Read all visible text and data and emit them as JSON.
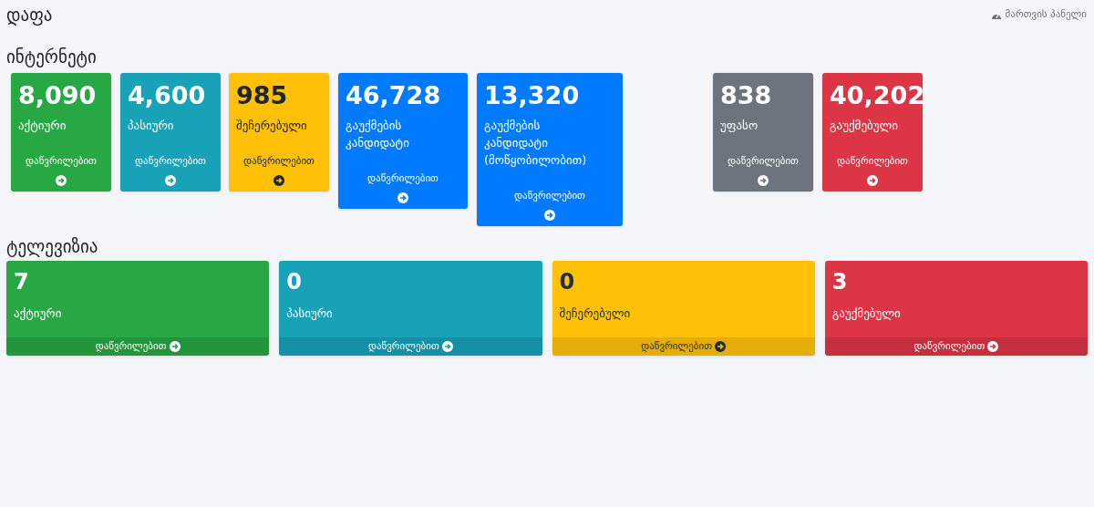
{
  "page_title": "დაფა",
  "breadcrumb": "მართვის პანელი",
  "internet": {
    "title": "ინტერნეტი",
    "cards": [
      {
        "value": "8,090",
        "label": "აქტიური",
        "color": "#28a745",
        "link": "დაწვრილებით"
      },
      {
        "value": "4,600",
        "label": "პასიური",
        "color": "#17a2b8",
        "link": "დაწვრილებით"
      },
      {
        "value": "985",
        "label": "შეჩერებული",
        "color": "#ffc107",
        "link": "დაწვრილებით"
      },
      {
        "value": "46,728",
        "label": "გაუქმების კანდიდატი",
        "color": "#007bff",
        "link": "დაწვრილებით"
      },
      {
        "value": "13,320",
        "label": "გაუქმების კანდიდატი (მოწყობილობით)",
        "color": "#007bff",
        "link": "დაწვრილებით"
      },
      {
        "value": "838",
        "label": "უფასო",
        "color": "#6c757d",
        "link": "დაწვრილებით"
      },
      {
        "value": "40,202",
        "label": "გაუქმებული",
        "color": "#dc3545",
        "link": "დაწვრილებით"
      }
    ]
  },
  "television": {
    "title": "ტელევიზია",
    "cards": [
      {
        "value": "7",
        "label": "აქტიური",
        "color": "#28a745",
        "link": "დაწვრილებით"
      },
      {
        "value": "0",
        "label": "პასიური",
        "color": "#17a2b8",
        "link": "დაწვრილებით"
      },
      {
        "value": "0",
        "label": "შეჩერებული",
        "color": "#ffc107",
        "link": "დაწვრილებით"
      },
      {
        "value": "3",
        "label": "გაუქმებული",
        "color": "#dc3545",
        "link": "დაწვრილებით"
      }
    ]
  }
}
